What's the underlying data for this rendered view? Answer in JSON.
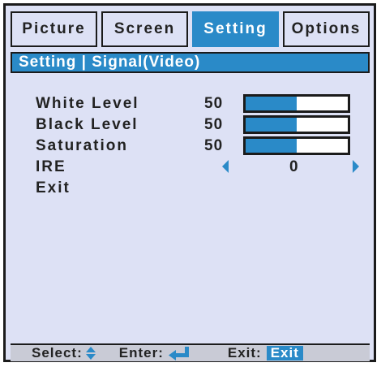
{
  "tabs": [
    {
      "label": "Picture",
      "active": false
    },
    {
      "label": "Screen",
      "active": false
    },
    {
      "label": "Setting",
      "active": true
    },
    {
      "label": "Options",
      "active": false
    }
  ],
  "breadcrumb": "Setting | Signal(Video)",
  "items": {
    "white_level": {
      "label": "White Level",
      "value": "50",
      "level_percent": 50
    },
    "black_level": {
      "label": "Black Level",
      "value": "50",
      "level_percent": 50
    },
    "saturation": {
      "label": "Saturation",
      "value": "50",
      "level_percent": 50
    },
    "ire": {
      "label": "IRE",
      "value": "0"
    },
    "exit": {
      "label": "Exit"
    }
  },
  "footer": {
    "select_label": "Select:",
    "enter_label": "Enter:",
    "exit_label": "Exit:",
    "exit_badge": "Exit"
  },
  "icons": {
    "select": "up-down-arrow-icon",
    "enter": "enter-return-icon",
    "ire_left": "triangle-left-icon",
    "ire_right": "triangle-right-icon"
  },
  "colors": {
    "accent": "#2a8ac8",
    "panel": "#dde1f5",
    "footer": "#c9cbd6",
    "border": "#1b1b1b"
  }
}
